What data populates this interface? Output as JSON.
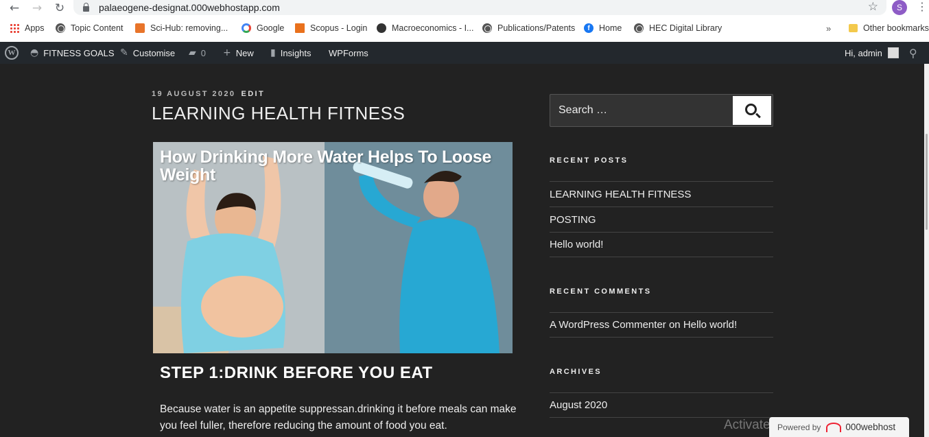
{
  "browser": {
    "url": "palaeogene-designat.000webhostapp.com",
    "profile_initial": "S",
    "bookmarks": [
      {
        "label": "Apps",
        "icon": "apps-grid-icon"
      },
      {
        "label": "Topic Content",
        "icon": "globe-icon"
      },
      {
        "label": "Sci-Hub: removing...",
        "icon": "scihub-icon"
      },
      {
        "label": "Google",
        "icon": "google-icon"
      },
      {
        "label": "Scopus - Login",
        "icon": "scopus-icon"
      },
      {
        "label": "Macroeconomics - I...",
        "icon": "macro-icon"
      },
      {
        "label": "Publications/Patents",
        "icon": "globe-icon"
      },
      {
        "label": "Home",
        "icon": "facebook-icon"
      },
      {
        "label": "HEC Digital Library",
        "icon": "globe-icon"
      }
    ],
    "more_label": "»",
    "other_bookmarks": "Other bookmarks"
  },
  "adminbar": {
    "site_name": "FITNESS GOALS",
    "customise": "Customise",
    "comments_count": "0",
    "new": "New",
    "insights": "Insights",
    "wpforms": "WPForms",
    "greeting": "Hi, admin"
  },
  "post": {
    "date": "19 AUGUST 2020",
    "edit": "EDIT",
    "title": "LEARNING HEALTH FITNESS",
    "image_caption": "How Drinking More Water Helps To Loose Weight",
    "step_heading": "STEP 1:DRINK BEFORE YOU EAT",
    "body": "Because water is an appetite suppressan.drinking it before meals can make you feel fuller, therefore reducing the amount of food you eat."
  },
  "sidebar": {
    "search_placeholder": "Search …",
    "recent_posts_title": "RECENT POSTS",
    "recent_posts": [
      "LEARNING HEALTH FITNESS",
      "POSTING",
      "Hello world!"
    ],
    "recent_comments_title": "RECENT COMMENTS",
    "recent_comment_author": "A WordPress Commenter",
    "recent_comment_on": "on",
    "recent_comment_post": "Hello world!",
    "archives_title": "ARCHIVES",
    "archives": [
      "August 2020"
    ]
  },
  "overlay": {
    "activate_text": "Activate",
    "powered_by": "Powered by",
    "host_brand": "000webhost"
  },
  "colors": {
    "background": "#222222",
    "adminbar": "#23282d",
    "profile": "#8e5cc6"
  }
}
